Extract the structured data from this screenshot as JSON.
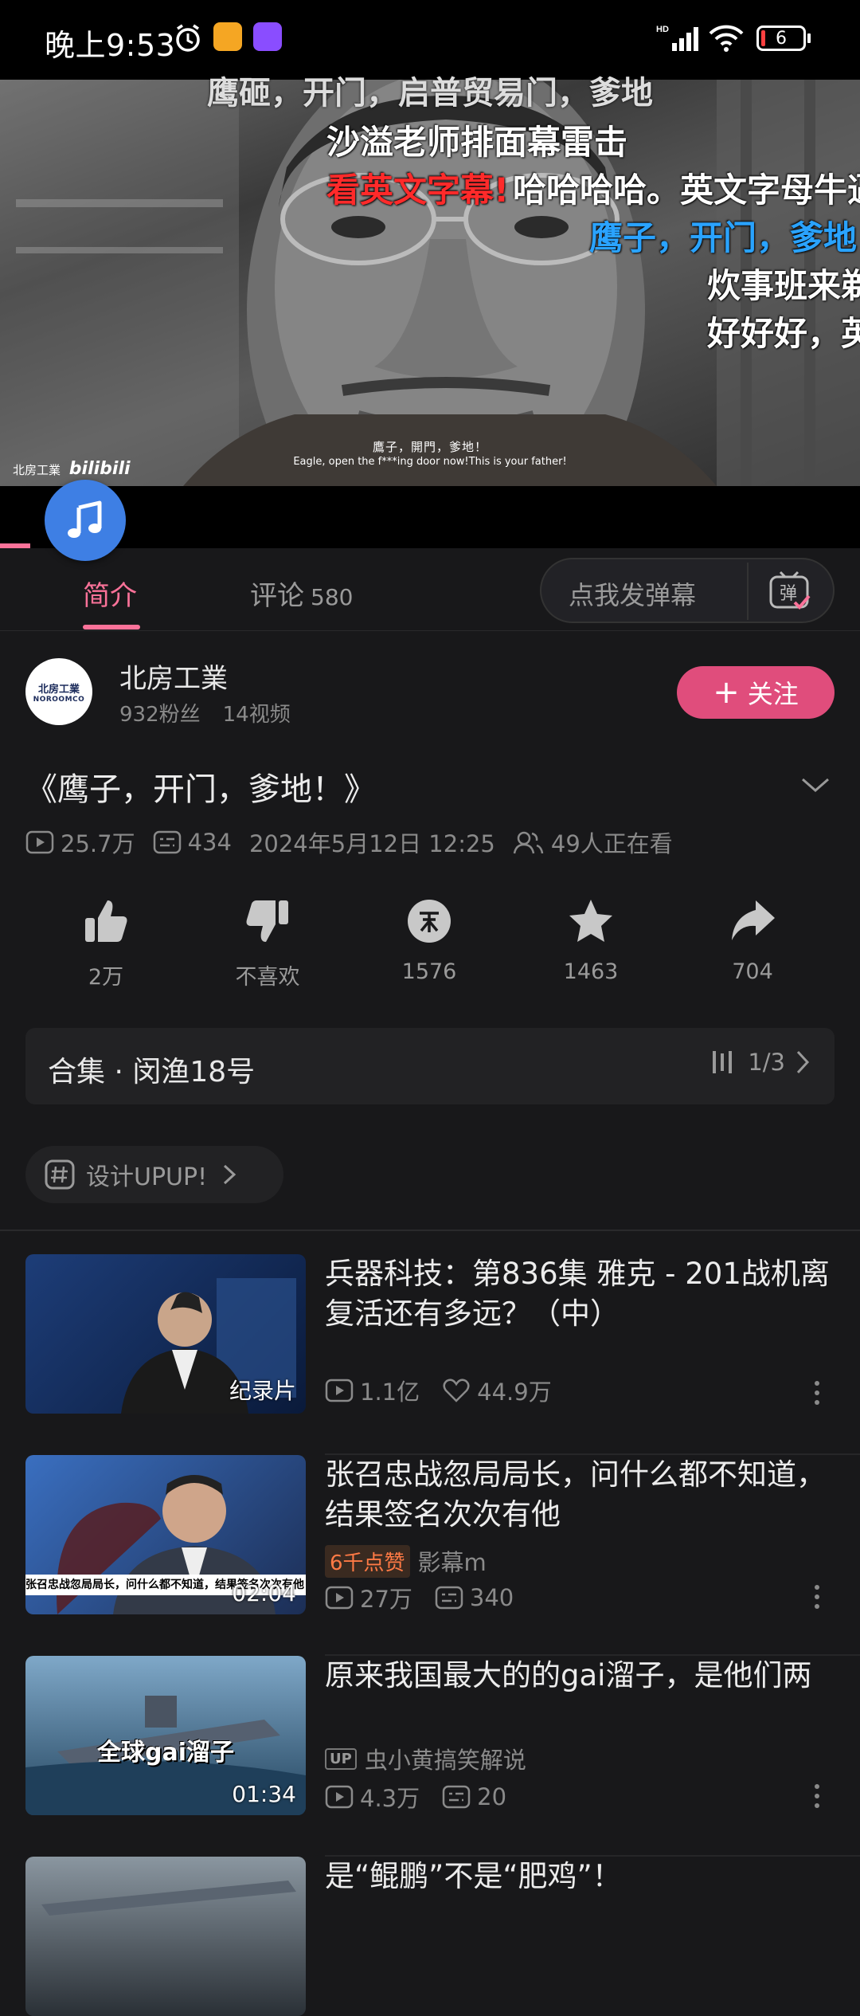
{
  "status_bar": {
    "time": "晚上9:53",
    "battery": "6"
  },
  "video": {
    "top_danmaku": "鹰砸，开门，启普贸易门，爹地",
    "danmaku": [
      {
        "text": "沙溢老师排面幕雷击",
        "color": "#ffffff"
      },
      {
        "text": "看英文字幕!",
        "color": "#ff2a2a"
      },
      {
        "text": "哈哈哈哈。英文字母牛逼",
        "color": "#ffffff"
      },
      {
        "text": "鹰子，开门，爹地",
        "color": "#2aa3ff"
      },
      {
        "text": "炊事班来剃",
        "color": "#ffffff"
      },
      {
        "text": "好好好，英",
        "color": "#ffffff"
      }
    ],
    "subtitle_cn": "鷹子，開門，爹地！",
    "subtitle_en": "Eagle, open the f***ing door now!This is your father!",
    "watermark_text": "北房工業",
    "watermark_logo": "bilibili"
  },
  "tabs": {
    "intro": "简介",
    "comments": "评论",
    "comments_count": "580"
  },
  "danmaku_input": {
    "placeholder": "点我发弹幕",
    "icon_label": "弹"
  },
  "uploader": {
    "name": "北房工業",
    "fans": "932粉丝",
    "videos": "14视频",
    "follow": "关注",
    "avatar_text": "北房工業",
    "avatar_sub": "NOROOMCO"
  },
  "video_info": {
    "title": "《鹰子，开门，爹地！》",
    "views": "25.7万",
    "danmaku_count": "434",
    "date": "2024年5月12日 12:25",
    "watching": "49人正在看"
  },
  "actions": [
    {
      "name": "like",
      "label": "2万"
    },
    {
      "name": "dislike",
      "label": "不喜欢"
    },
    {
      "name": "coin",
      "label": "1576"
    },
    {
      "name": "favorite",
      "label": "1463"
    },
    {
      "name": "share",
      "label": "704"
    }
  ],
  "collection": {
    "title": "合集 · 闵渔18号",
    "progress": "1/3"
  },
  "topic": {
    "label": "设计UPUP!"
  },
  "recommendations": [
    {
      "title": "兵器科技：第836集 雅克 - 201战机离复活还有多远？（中）",
      "thumb_label": "纪录片",
      "views": "1.1亿",
      "likes": "44.9万",
      "thumb_colors": [
        "#1d3d78",
        "#0a1a3a"
      ]
    },
    {
      "title": "张召忠战忽局局长，问什么都不知道，结果签名次次有他",
      "duration": "02:04",
      "badge": "6千点赞",
      "uploader": "影幕m",
      "views": "27万",
      "danmaku": "340",
      "thumb_caption": "张召忠战忽局局长，问什么都不知道，结果签名次次有他",
      "thumb_colors": [
        "#3a6fc0",
        "#1c2e55"
      ]
    },
    {
      "title": "原来我国最大的的gai溜子，是他们两",
      "duration": "01:34",
      "uploader": "虫小黄搞笑解说",
      "views": "4.3万",
      "danmaku": "20",
      "thumb_caption": "全球gai溜子",
      "thumb_colors": [
        "#5f8fb8",
        "#23445e"
      ]
    },
    {
      "title": "是“鲲鹏”不是“肥鸡”！",
      "thumb_colors": [
        "#6f7a84",
        "#2a3036"
      ]
    }
  ]
}
